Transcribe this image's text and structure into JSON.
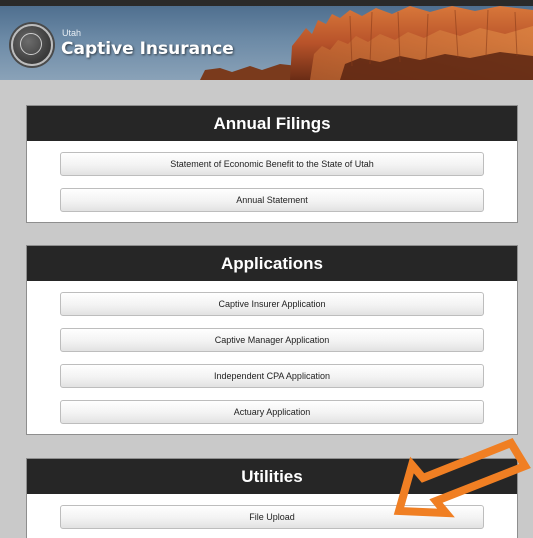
{
  "header": {
    "state_label": "Utah",
    "title": "Captive Insurance",
    "seal_icon": "utah-state-seal-icon"
  },
  "sections": [
    {
      "title": "Annual Filings",
      "buttons": [
        {
          "label": "Statement of Economic Benefit to the State of Utah"
        },
        {
          "label": "Annual Statement"
        }
      ]
    },
    {
      "title": "Applications",
      "buttons": [
        {
          "label": "Captive Insurer Application"
        },
        {
          "label": "Captive Manager Application"
        },
        {
          "label": "Independent CPA Application"
        },
        {
          "label": "Actuary Application"
        }
      ]
    },
    {
      "title": "Utilities",
      "buttons": [
        {
          "label": "File Upload"
        }
      ]
    }
  ],
  "annotation": {
    "icon": "orange-arrow-icon",
    "color": "#f07f23"
  }
}
